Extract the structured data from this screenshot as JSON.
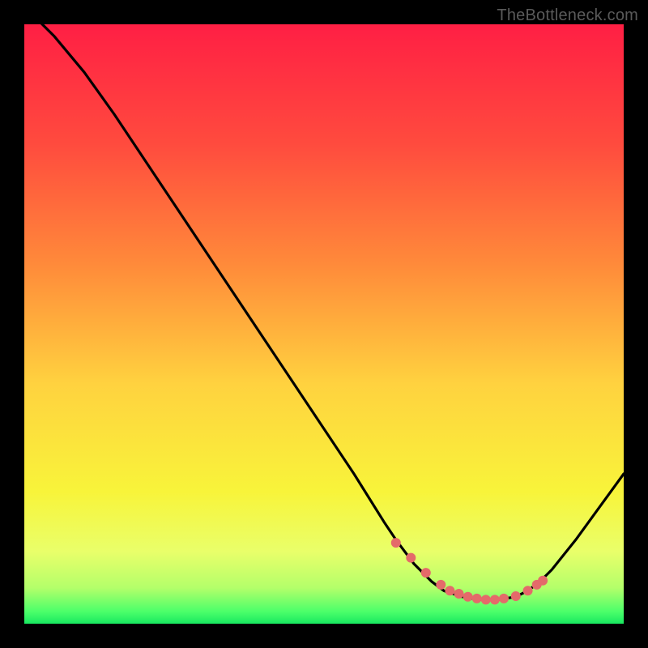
{
  "watermark": "TheBottleneck.com",
  "chart_data": {
    "type": "line",
    "title": "",
    "xlabel": "",
    "ylabel": "",
    "xlim": [
      0,
      100
    ],
    "ylim": [
      0,
      100
    ],
    "gradient_stops": [
      {
        "offset": 0,
        "color": "#ff1f44"
      },
      {
        "offset": 20,
        "color": "#ff4b3e"
      },
      {
        "offset": 40,
        "color": "#ff8a3a"
      },
      {
        "offset": 60,
        "color": "#ffd23f"
      },
      {
        "offset": 78,
        "color": "#f8f43a"
      },
      {
        "offset": 88,
        "color": "#e9ff6a"
      },
      {
        "offset": 94,
        "color": "#b4ff6a"
      },
      {
        "offset": 98,
        "color": "#4bff6a"
      },
      {
        "offset": 100,
        "color": "#18e860"
      }
    ],
    "series": [
      {
        "name": "bottleneck-curve",
        "color": "#000000",
        "x": [
          0,
          2,
          5,
          10,
          15,
          20,
          25,
          30,
          35,
          40,
          45,
          50,
          55,
          60,
          62,
          65,
          68,
          70,
          73,
          76,
          79,
          82,
          84,
          86,
          88,
          92,
          96,
          100
        ],
        "values": [
          103,
          101,
          98,
          92,
          85,
          77.5,
          70,
          62.5,
          55,
          47.5,
          40,
          32.5,
          25,
          17,
          14,
          10,
          7,
          5.5,
          4.5,
          4,
          4,
          4.5,
          5.5,
          7,
          9,
          14,
          19.5,
          25
        ]
      }
    ],
    "markers": {
      "name": "optimal-zone",
      "color": "#e46a6a",
      "radius": 6,
      "x": [
        62,
        64.5,
        67,
        69.5,
        71,
        72.5,
        74,
        75.5,
        77,
        78.5,
        80,
        82,
        84,
        85.5,
        86.5
      ],
      "values": [
        13.5,
        11,
        8.5,
        6.5,
        5.5,
        5,
        4.5,
        4.2,
        4,
        4,
        4.2,
        4.6,
        5.5,
        6.5,
        7.2
      ]
    }
  }
}
